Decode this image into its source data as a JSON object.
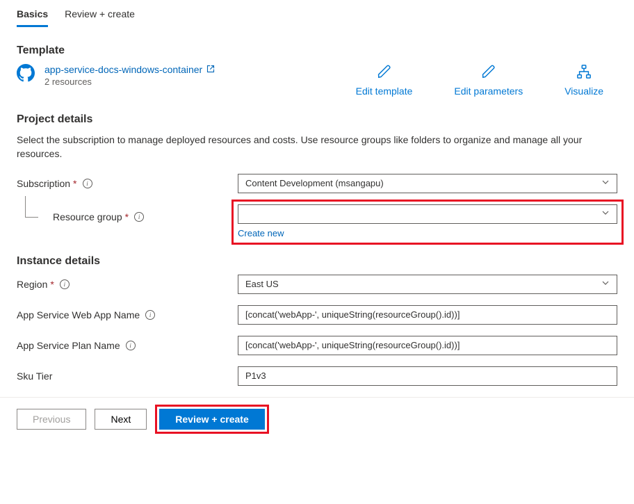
{
  "tabs": {
    "basics": "Basics",
    "review_create": "Review + create"
  },
  "template": {
    "heading": "Template",
    "link": "app-service-docs-windows-container",
    "resources": "2 resources",
    "actions": {
      "edit_template": "Edit template",
      "edit_parameters": "Edit parameters",
      "visualize": "Visualize"
    }
  },
  "project_details": {
    "heading": "Project details",
    "description": "Select the subscription to manage deployed resources and costs. Use resource groups like folders to organize and manage all your resources.",
    "subscription_label": "Subscription",
    "subscription_value": "Content Development (msangapu)",
    "resource_group_label": "Resource group",
    "resource_group_value": "",
    "create_new": "Create new"
  },
  "instance_details": {
    "heading": "Instance details",
    "region_label": "Region",
    "region_value": "East US",
    "webapp_label": "App Service Web App Name",
    "webapp_value": "[concat('webApp-', uniqueString(resourceGroup().id))]",
    "plan_label": "App Service Plan Name",
    "plan_value": "[concat('webApp-', uniqueString(resourceGroup().id))]",
    "sku_label": "Sku Tier",
    "sku_value": "P1v3"
  },
  "footer": {
    "previous": "Previous",
    "next": "Next",
    "review_create": "Review + create"
  }
}
